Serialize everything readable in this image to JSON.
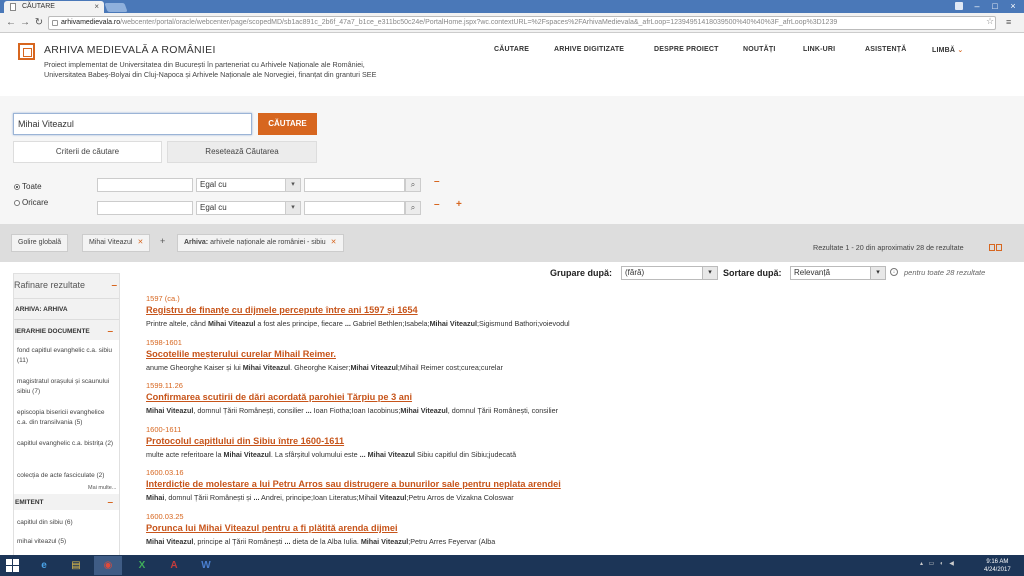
{
  "browser": {
    "tab_title": "CĂUTARE",
    "url_host": "arhivamedievala.ro",
    "url_path": "/webcenter/portal/oracle/webcenter/page/scopedMD/sb1ac891c_2b6f_47a7_b1ce_e311bc50c24e/PortalHome.jspx?wc.contextURL=%2Fspaces%2FArhivaMedievala&_afrLoop=12394951418039500%40%40%3F_afrLoop%3D1239"
  },
  "site": {
    "title": "ARHIVA MEDIEVALĂ A ROMÂNIEI",
    "subtitle_line1": "Proiect implementat de Universitatea din București în parteneriat cu Arhivele Naționale ale României,",
    "subtitle_line2": "Universitatea Babeș-Bolyai din Cluj-Napoca și Arhivele Naționale ale Norvegiei, finanțat din granturi SEE",
    "nav": [
      "CĂUTARE",
      "ARHIVE DIGITIZATE",
      "DESPRE PROIECT",
      "NOUTĂȚI",
      "LINK-URI",
      "ASISTENȚĂ",
      "LIMBĂ"
    ]
  },
  "search": {
    "query": "Mihai Viteazul",
    "search_button": "CĂUTARE",
    "criteria_button": "Criterii de căutare",
    "reset_button": "Resetează Căutarea",
    "radio_all": "Toate",
    "radio_any": "Oricare",
    "operator_1": "Egal cu",
    "operator_2": "Egal cu",
    "minus": "–",
    "plus": "+"
  },
  "filters": {
    "clear_all": "Golire globală",
    "chip_query": "Mihai Viteazul",
    "chip_archive_label": "Arhiva:",
    "chip_archive_value": "arhivele naționale ale româniei - sibiu",
    "plus": "+",
    "result_count": "Rezultate 1 - 20 din aproximativ 28 de rezultate"
  },
  "sorting": {
    "group_label": "Grupare după:",
    "group_value": "(fără)",
    "sort_label": "Sortare după:",
    "sort_value": "Relevanță",
    "apply_all": "pentru toate 28 rezultate"
  },
  "sidebar": {
    "title": "Rafinare rezultate",
    "archive_heading": "ARHIVA: ARHIVA",
    "hierarchy_heading": "IERARHIE DOCUMENTE",
    "hierarchy_items": [
      "fond capitlul evanghelic c.a. sibiu (11)",
      "magistratul orașului și scaunului sibiu (7)",
      "episcopia bisericii evanghelice c.a. din transilvania (5)",
      "capitlul evanghelic c.a. bistrița (2)",
      "colecția de acte fasciculate (2)"
    ],
    "more": "Mai multe...",
    "issuer_heading": "EMITENT",
    "issuer_items": [
      "capitlul din sibiu (6)",
      "mihai viteazul (5)"
    ]
  },
  "results": [
    {
      "date": "1597 (ca.)",
      "title": "Registru de finanțe cu dijmele percepute între ani 1597 și 1654",
      "snippet": "Printre altele, când <b>Mihai Viteazul</b> a fost ales principe, fiecare <b>...</b> Gabriel Bethlen;Isabela;<b>Mihai Viteazul</b>;Sigismund Bathori;voievodul"
    },
    {
      "date": "1598-1601",
      "title": "Socotelile meșterului curelar Mihail Reimer.",
      "snippet": "anume Gheorghe Kaiser și lui <b>Mihai Viteazul</b>. Gheorghe Kaiser;<b>Mihai Viteazul</b>;Mihail Reimer cost;curea;curelar"
    },
    {
      "date": "1599.11.26",
      "title": "Confirmarea scutirii de dări acordată parohiei Tărpiu pe 3 ani",
      "snippet": "<b>Mihai Viteazul</b>, domnul Țării Românești, consilier <b>...</b> Ioan Fiotha;Ioan Iacobinus;<b>Mihai Viteazul</b>, domnul Țării Românești, consilier"
    },
    {
      "date": "1600-1611",
      "title": "Protocolul capitlului din Sibiu între 1600-1611",
      "snippet": "multe acte referitoare la <b>Mihai Viteazul</b>. La sfârșitul volumului este <b>...</b> <b>Mihai Viteazul</b> Sibiu capitlul din Sibiu;judecată"
    },
    {
      "date": "1600.03.16",
      "title": "Interdicție de molestare a lui Petru Arros sau distrugere a bunurilor sale pentru neplata arendei",
      "snippet": "<b>Mihai</b>, domnul Țării Românești și <b>...</b> Andrei, principe;Ioan Literatus;Mihail <b>Viteazul</b>;Petru Arros de Vizakna Coloswar"
    },
    {
      "date": "1600.03.25",
      "title": "Porunca lui Mihai Viteazul pentru a fi plătită arenda dijmei",
      "snippet": "<b>Mihai Viteazul</b>, principe al Țării Românești <b>...</b> dieta de la Alba Iulia. <b>Mihai Viteazul</b>;Petru Arres Feyervar (Alba"
    }
  ],
  "taskbar": {
    "time": "9:16 AM",
    "date": "4/24/2017",
    "apps": [
      "e",
      "▤",
      "◉",
      "X",
      "A",
      "W"
    ]
  }
}
